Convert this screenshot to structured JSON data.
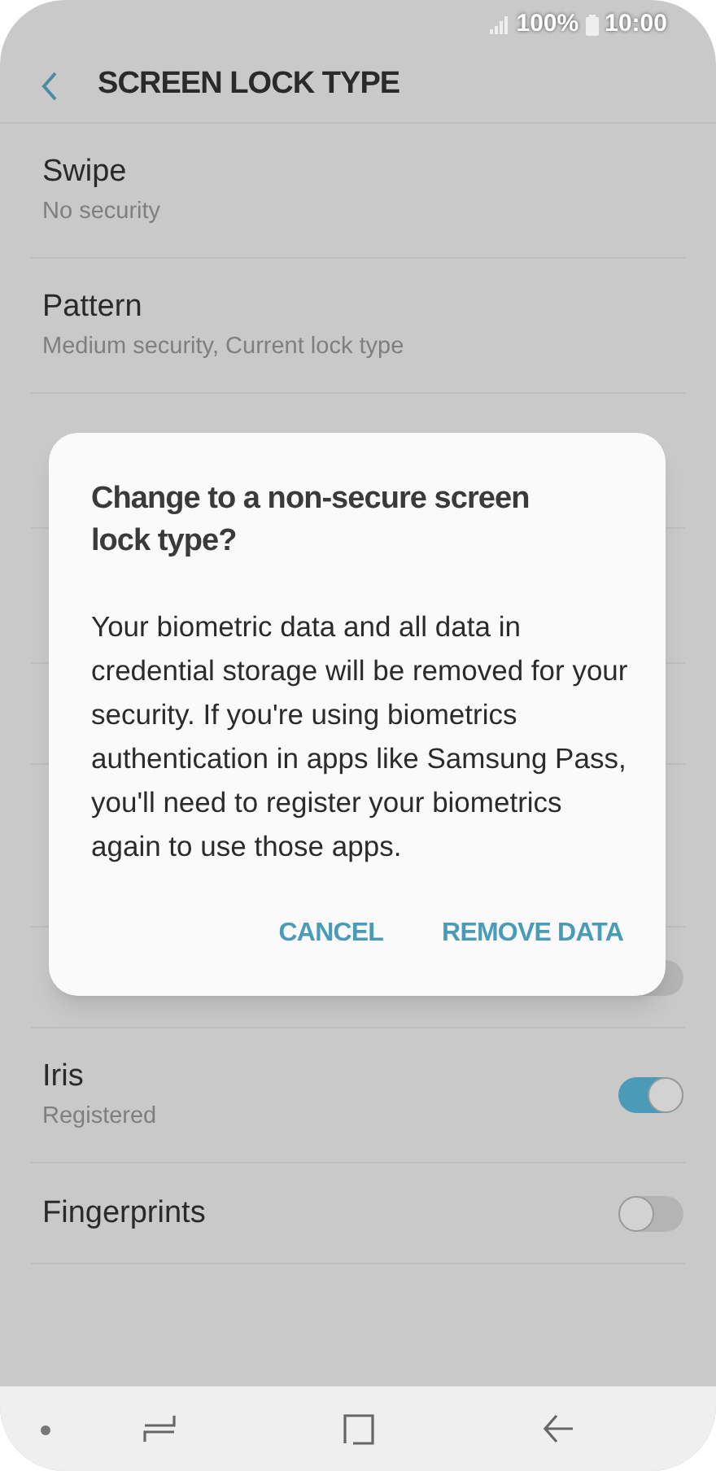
{
  "status_bar": {
    "battery": "100%",
    "time": "10:00"
  },
  "header": {
    "title": "SCREEN LOCK TYPE"
  },
  "items": [
    {
      "kind": "row",
      "title": "Swipe",
      "subtitle": "No security"
    },
    {
      "kind": "row",
      "title": "Pattern",
      "subtitle": "Medium security, Current lock type"
    },
    {
      "kind": "covered_tall"
    },
    {
      "kind": "covered_tall"
    },
    {
      "kind": "covered"
    },
    {
      "kind": "covered_section"
    },
    {
      "kind": "covered"
    },
    {
      "kind": "covered",
      "on": false
    },
    {
      "kind": "row",
      "title": "Iris",
      "subtitle": "Registered",
      "on": true
    },
    {
      "kind": "row",
      "title": "Fingerprints",
      "on": false
    }
  ],
  "dialog": {
    "title": "Change to a non-secure screen lock type?",
    "message": "Your biometric data and all data in credential storage will be removed for your security. If you're using biometrics authentication in apps like Samsung Pass, you'll need to register your biometrics again to use those apps.",
    "buttons": [
      "CANCEL",
      "REMOVE DATA"
    ]
  }
}
